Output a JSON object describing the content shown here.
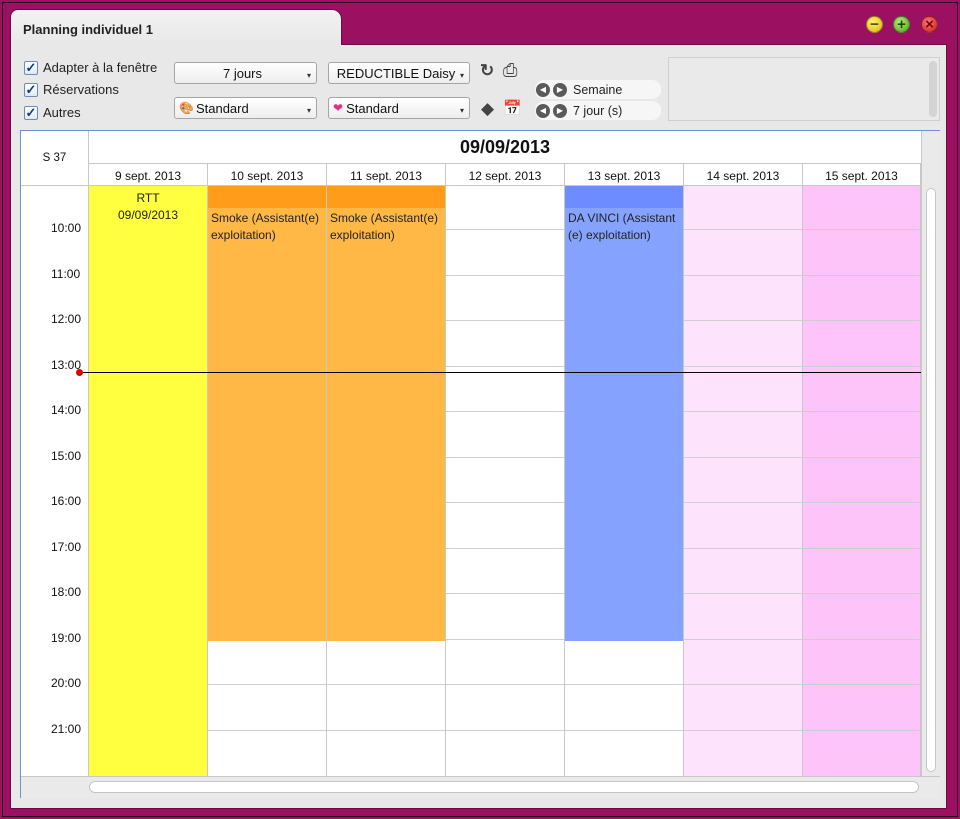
{
  "window": {
    "title": "Planning individuel 1",
    "minimize_label": "−",
    "maximize_label": "+",
    "close_label": "×"
  },
  "options": {
    "fit_window": {
      "label": "Adapter à la fenêtre",
      "checked": true,
      "check": "✓"
    },
    "reservations": {
      "label": "Réservations",
      "checked": true,
      "check": "✓"
    },
    "others": {
      "label": "Autres",
      "checked": true,
      "check": "✓"
    }
  },
  "selectors": {
    "period": "7 jours",
    "person": "REDUCTIBLE Daisy",
    "style_left": "Standard",
    "style_right": "Standard",
    "arrow": "▾"
  },
  "icons": {
    "refresh": "↻",
    "print": "⎙",
    "palette": "🎨",
    "hearts": "❤",
    "diamond": "◆",
    "calendar": "📅"
  },
  "navigation": {
    "week": {
      "prev": "◀",
      "next": "▶",
      "label": "Semaine"
    },
    "days": {
      "prev": "◀",
      "next": "▶",
      "label": "7 jour (s)"
    }
  },
  "calendar": {
    "week_label": "S 37",
    "current_date": "09/09/2013",
    "days": [
      "9 sept. 2013",
      "10 sept. 2013",
      "11 sept. 2013",
      "12 sept. 2013",
      "13 sept. 2013",
      "14 sept. 2013",
      "15 sept. 2013"
    ],
    "hours": [
      "10:00",
      "11:00",
      "12:00",
      "13:00",
      "14:00",
      "15:00",
      "16:00",
      "17:00",
      "18:00",
      "19:00",
      "20:00",
      "21:00"
    ],
    "events": [
      {
        "day": 0,
        "line1": "RTT",
        "line2": "09/09/2013"
      },
      {
        "day": 1,
        "text": "Smoke (Assistant(e) exploitation)"
      },
      {
        "day": 2,
        "text": "Smoke (Assistant(e) exploitation)"
      },
      {
        "day": 4,
        "text": "DA VINCI (Assistant (e) exploitation)"
      }
    ],
    "colors": {
      "rtt": "#ffff40",
      "smoke": "#ffb846",
      "smoke_bar": "#ff9c1a",
      "davinci": "#86a2ff",
      "davinci_bar": "#6c8cff",
      "weekend_sat": "#fde3fb",
      "weekend_sun": "#fcc4f8",
      "now_dot": "#e00000"
    }
  }
}
